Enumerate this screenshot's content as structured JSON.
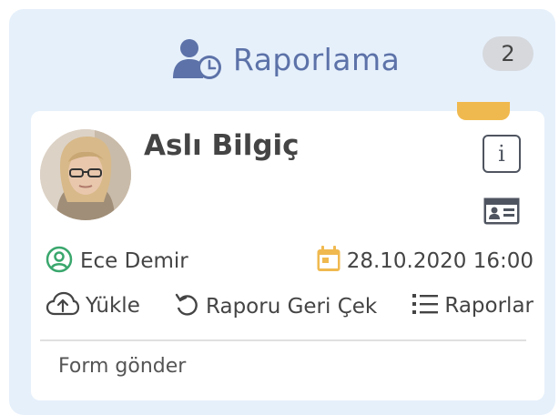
{
  "panel": {
    "title": "Raporlama",
    "title_icon": "user-clock-icon",
    "count": "2"
  },
  "card": {
    "person_name": "Aslı Bilgiç",
    "avatar_icon": "avatar-photo",
    "info_icon_glyph": "i",
    "id_card_icon": "id-card-icon",
    "tag_color": "#f0b94f",
    "assignee": {
      "icon": "user-circle-icon",
      "name": "Ece Demir",
      "icon_color": "#3aa76d"
    },
    "date": {
      "icon": "calendar-icon",
      "text": "28.10.2020 16:00",
      "icon_color": "#f0b94f"
    },
    "actions": {
      "upload_label": "Yükle",
      "revert_label": "Raporu Geri Çek",
      "reports_label": "Raporlar"
    },
    "form_send_label": "Form gönder"
  },
  "colors": {
    "panel_bg": "#e6f0fb",
    "title": "#5c72a8",
    "text": "#444444"
  }
}
